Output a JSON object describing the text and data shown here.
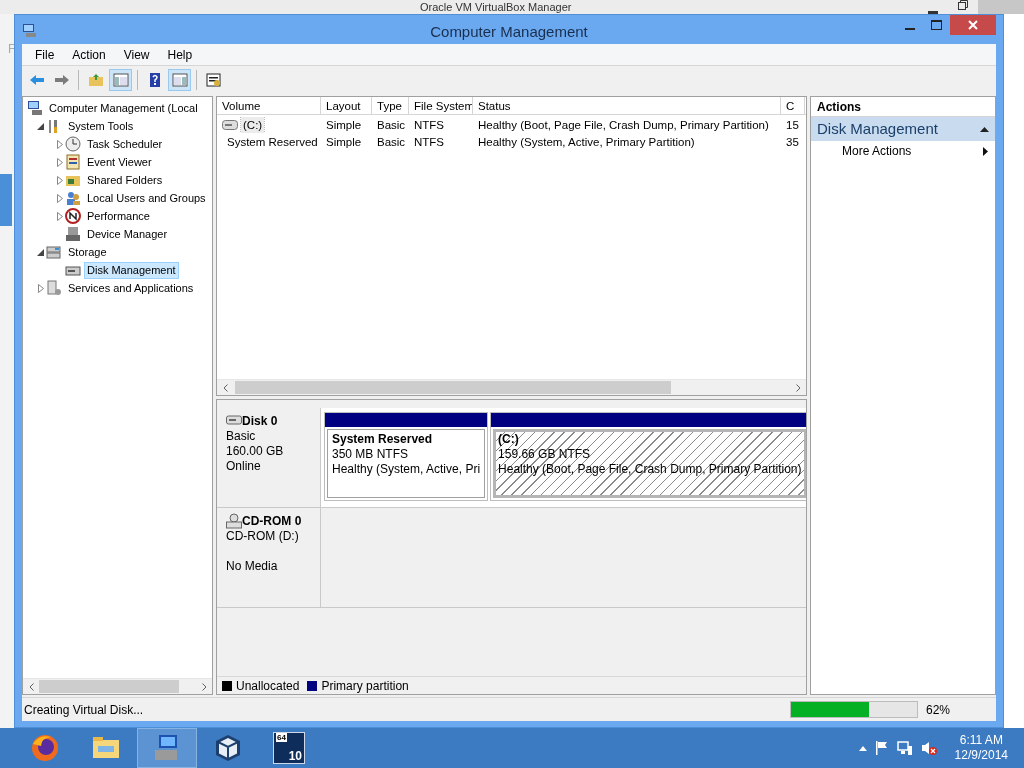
{
  "background_window": {
    "title": "Oracle VM VirtualBox Manager",
    "menu_fragment": "F"
  },
  "window": {
    "title": "Computer Management"
  },
  "menu": [
    "File",
    "Action",
    "View",
    "Help"
  ],
  "toolbar": [
    {
      "kind": "back",
      "pressed": false
    },
    {
      "kind": "forward",
      "pressed": false
    },
    {
      "kind": "up",
      "pressed": false
    },
    {
      "kind": "tree-pane",
      "pressed": true
    },
    {
      "kind": "help",
      "pressed": false
    },
    {
      "kind": "action-pane",
      "pressed": true
    },
    {
      "kind": "properties",
      "pressed": false
    }
  ],
  "tree": [
    {
      "label": "Computer Management (Local",
      "selected": false,
      "children": [
        {
          "label": "System Tools",
          "expanded": true,
          "selected": false,
          "children": [
            {
              "label": "Task Scheduler",
              "expanded": false,
              "selected": false
            },
            {
              "label": "Event Viewer",
              "expanded": false,
              "selected": false
            },
            {
              "label": "Shared Folders",
              "expanded": false,
              "selected": false
            },
            {
              "label": "Local Users and Groups",
              "expanded": false,
              "selected": false
            },
            {
              "label": "Performance",
              "expanded": false,
              "selected": false
            },
            {
              "label": "Device Manager",
              "selected": false
            }
          ]
        },
        {
          "label": "Storage",
          "expanded": true,
          "selected": false,
          "children": [
            {
              "label": "Disk Management",
              "selected": true
            }
          ]
        },
        {
          "label": "Services and Applications",
          "expanded": false,
          "selected": false
        }
      ]
    }
  ],
  "volumes": {
    "columns": [
      "Volume",
      "Layout",
      "Type",
      "File System",
      "Status",
      "C"
    ],
    "rows": [
      {
        "cells": [
          "(C:)",
          "Simple",
          "Basic",
          "NTFS",
          "Healthy (Boot, Page File, Crash Dump, Primary Partition)",
          "15"
        ],
        "selected": true
      },
      {
        "cells": [
          "System Reserved",
          "Simple",
          "Basic",
          "NTFS",
          "Healthy (System, Active, Primary Partition)",
          "35"
        ],
        "selected": false
      }
    ]
  },
  "disks": [
    {
      "name": "Disk 0",
      "kind": "disk",
      "lines": [
        "Basic",
        "160.00 GB",
        "Online"
      ],
      "partitions": [
        {
          "name": "System Reserved",
          "size": "350 MB NTFS",
          "status": "Healthy (System, Active, Pri",
          "selected": false
        },
        {
          "name": "(C:)",
          "size": "159.66 GB NTFS",
          "status": "Healthy (Boot, Page File, Crash Dump, Primary Partition)",
          "selected": true
        }
      ]
    },
    {
      "name": "CD-ROM 0",
      "kind": "cdrom",
      "lines": [
        "CD-ROM (D:)",
        "No Media"
      ]
    }
  ],
  "legend": [
    {
      "label": "Unallocated",
      "color": "#000000"
    },
    {
      "label": "Primary partition",
      "color": "#000080"
    }
  ],
  "actions": {
    "title": "Actions",
    "section": "Disk Management",
    "expanded": true,
    "items": [
      "More Actions"
    ]
  },
  "status_bar": {
    "text": "Creating Virtual Disk...",
    "progress": {
      "level": 0.62,
      "reading": "62%"
    }
  },
  "taskbar": {
    "items": [
      {
        "kind": "firefox",
        "selected": false
      },
      {
        "kind": "explorer",
        "selected": false
      },
      {
        "kind": "computer-management",
        "selected": true
      },
      {
        "kind": "virtualbox",
        "selected": false
      },
      {
        "kind": "hyper",
        "selected": false,
        "labels": [
          "64",
          "10"
        ]
      }
    ],
    "time": "6:11 AM",
    "date": "12/9/2014"
  }
}
